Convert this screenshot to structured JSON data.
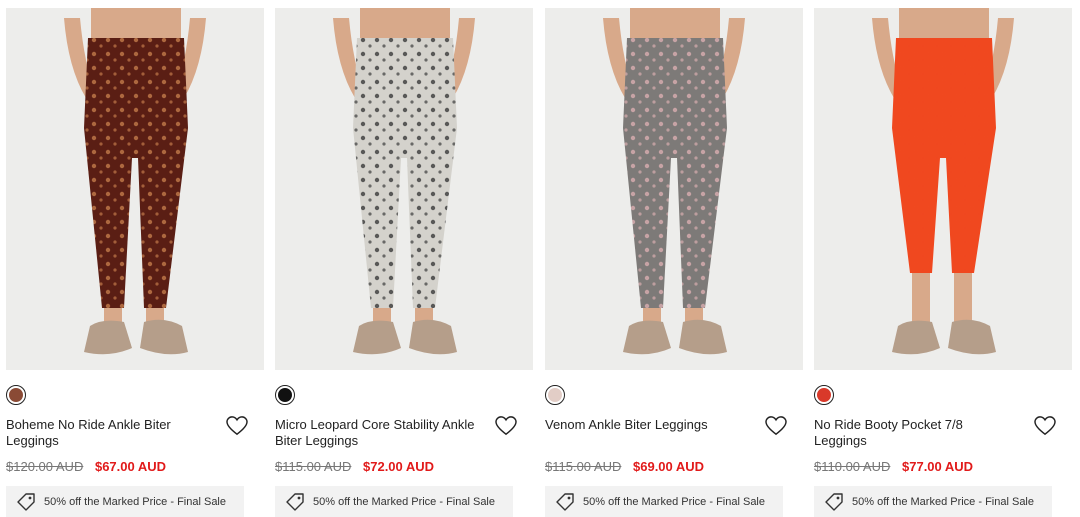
{
  "products": [
    {
      "name": "Boheme No Ride Ankle Biter Leggings",
      "was_price": "$120.00 AUD",
      "sale_price": "$67.00 AUD",
      "swatch_color": "#8a4a35",
      "legging_color": "#5a1e14",
      "pattern_color": "#c27a4a",
      "promo": "50% off the Marked Price - Final Sale",
      "wishlist_icon": "heart-icon",
      "promo_icon": "tag-icon"
    },
    {
      "name": "Micro Leopard Core Stability Ankle Biter Leggings",
      "was_price": "$115.00 AUD",
      "sale_price": "$72.00 AUD",
      "swatch_color": "#111111",
      "legging_color": "#d4d2cc",
      "pattern_color": "#3a3a3a",
      "promo": "50% off the Marked Price - Final Sale",
      "wishlist_icon": "heart-icon",
      "promo_icon": "tag-icon"
    },
    {
      "name": "Venom Ankle Biter Leggings",
      "was_price": "$115.00 AUD",
      "sale_price": "$69.00 AUD",
      "swatch_color": "#e2cdc6",
      "legging_color": "#7d7a78",
      "pattern_color": "#d9aeb0",
      "promo": "50% off the Marked Price - Final Sale",
      "wishlist_icon": "heart-icon",
      "promo_icon": "tag-icon"
    },
    {
      "name": "No Ride Booty Pocket 7/8 Leggings",
      "was_price": "$110.00 AUD",
      "sale_price": "$77.00 AUD",
      "swatch_color": "#d9392a",
      "legging_color": "#f0481f",
      "pattern_color": "#f0481f",
      "promo": "50% off the Marked Price - Final Sale",
      "wishlist_icon": "heart-icon",
      "promo_icon": "tag-icon"
    }
  ],
  "colors": {
    "sale_red": "#e11a1a",
    "strike_gray": "#777777",
    "promo_bg": "#f2f2f2",
    "photo_bg": "#ececea",
    "skin": "#d8a98a",
    "sneaker": "#b59e8a"
  }
}
